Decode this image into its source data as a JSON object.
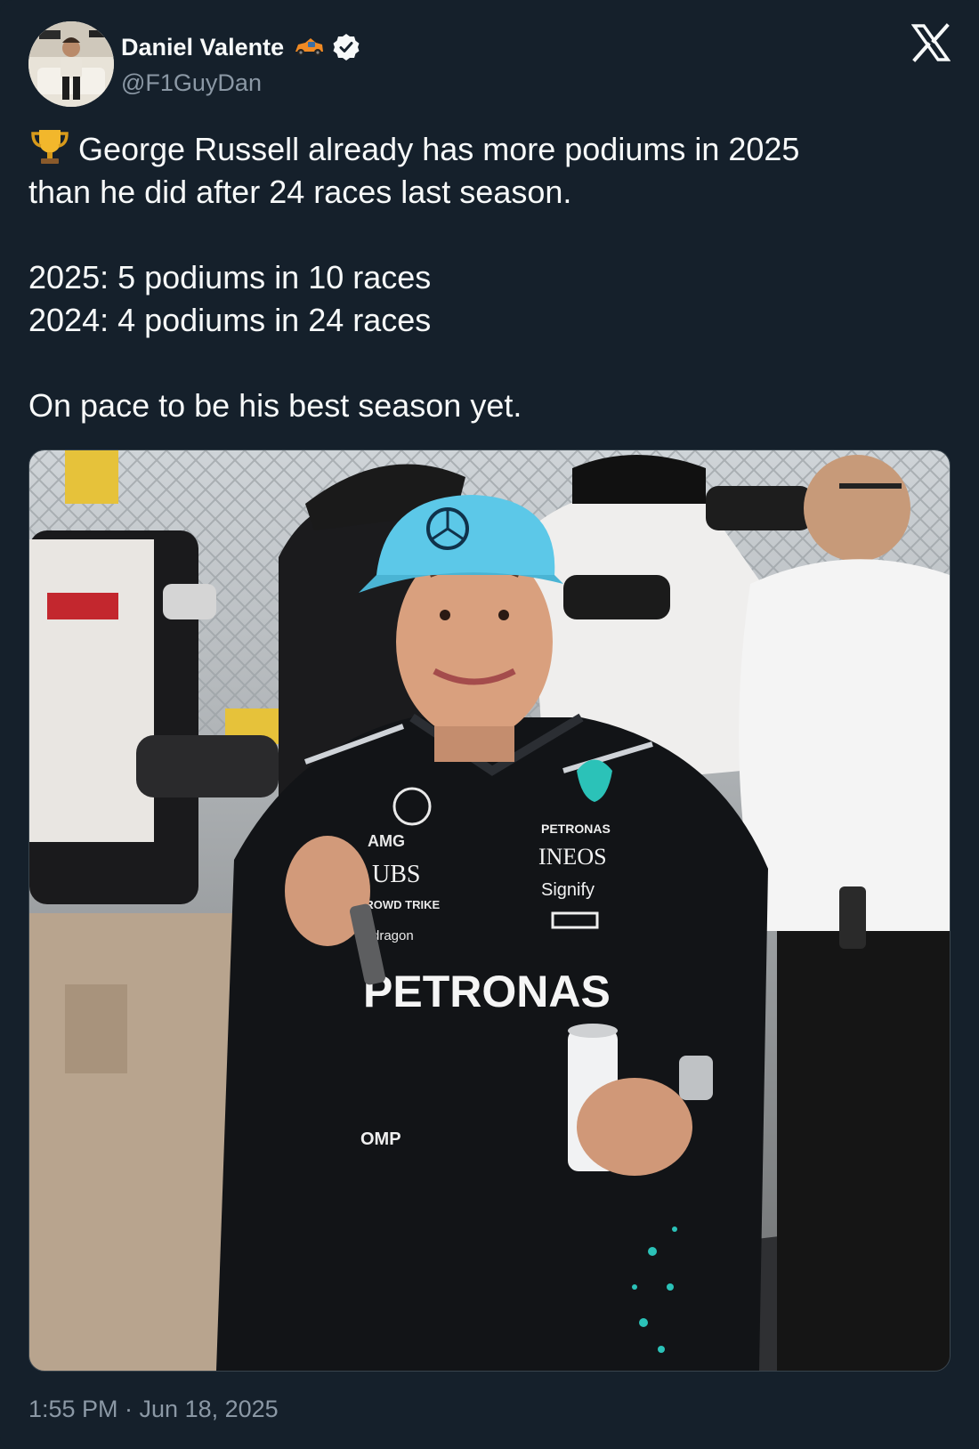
{
  "author": {
    "name": "Daniel Valente",
    "handle": "@F1GuyDan",
    "verified": true,
    "emoji": "race-car-emoji"
  },
  "tweet": {
    "line1": "George Russell already has more podiums in 2025",
    "line2": "than he did after 24 races last season.",
    "line3": "2025: 5 podiums in 10 races",
    "line4": "2024: 4 podiums in 24 races",
    "line5": "On pace to be his best season yet.",
    "leading_emoji": "trophy-icon"
  },
  "photo": {
    "cap_brand": "Mercedes",
    "suit_sponsors": [
      "AMG",
      "UBS",
      "CROWD TRIKE",
      "dragon",
      "PETRONAS",
      "INEOS",
      "Signify",
      "Hewlett Packard Enterprise",
      "OMP"
    ]
  },
  "timestamp": "1:55 PM · Jun 18, 2025",
  "colors": {
    "background": "#15202b",
    "text": "#f7f9f9",
    "muted": "#8b98a5",
    "cap": "#5cc8e8",
    "petronas_teal": "#2bc2b8"
  }
}
